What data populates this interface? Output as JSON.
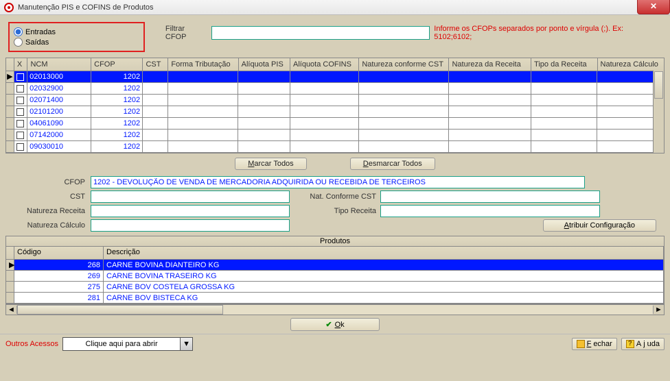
{
  "title": "Manutenção PIS e COFINS de Produtos",
  "radios": {
    "entradas": "Entradas",
    "saidas": "Saídas"
  },
  "filter": {
    "label": "Filtrar CFOP",
    "value": "",
    "hint": "Informe os CFOPs separados por ponto e vírgula (;). Ex: 5102;6102;"
  },
  "grid": {
    "headers": {
      "x": "X",
      "ncm": "NCM",
      "cfop": "CFOP",
      "cst": "CST",
      "ft": "Forma Tributação",
      "apis": "Alíquota PIS",
      "acof": "Alíquota COFINS",
      "ncst": "Natureza conforme CST",
      "nrec": "Natureza da Receita",
      "trec": "Tipo da Receita",
      "ncalc": "Natureza Cálculo"
    },
    "rows": [
      {
        "ncm": "02013000",
        "cfop": "1202",
        "selected": true
      },
      {
        "ncm": "02032900",
        "cfop": "1202"
      },
      {
        "ncm": "02071400",
        "cfop": "1202"
      },
      {
        "ncm": "02101200",
        "cfop": "1202"
      },
      {
        "ncm": "04061090",
        "cfop": "1202"
      },
      {
        "ncm": "07142000",
        "cfop": "1202"
      },
      {
        "ncm": "09030010",
        "cfop": "1202"
      }
    ]
  },
  "buttons": {
    "marcar": "Marcar Todos",
    "desmarcar": "Desmarcar Todos",
    "atribuir": "Atribuir Configuração",
    "ok": "Ok",
    "fechar": "Fechar",
    "ajuda": "Ajuda"
  },
  "icons": {
    "marcar_u": "M",
    "desmarcar_u": "D",
    "atribuir_u": "A",
    "ok_u": "O",
    "fechar_u": "F",
    "ajuda_u": "j"
  },
  "form": {
    "cfop_label": "CFOP",
    "cfop_value": "1202 - DEVOLUÇÃO DE VENDA DE MERCADORIA ADQUIRIDA OU RECEBIDA DE TERCEIROS",
    "cst_label": "CST",
    "cst_value": "",
    "ncst_label": "Nat. Conforme CST",
    "ncst_value": "",
    "nrec_label": "Natureza Receita",
    "nrec_value": "",
    "trec_label": "Tipo Receita",
    "trec_value": "",
    "ncalc_label": "Natureza Cálculo",
    "ncalc_value": ""
  },
  "produtos": {
    "title": "Produtos",
    "headers": {
      "codigo": "Código",
      "descricao": "Descrição"
    },
    "rows": [
      {
        "codigo": "268",
        "descricao": "CARNE BOVINA DIANTEIRO KG",
        "selected": true
      },
      {
        "codigo": "269",
        "descricao": "CARNE BOVINA TRASEIRO KG"
      },
      {
        "codigo": "275",
        "descricao": "CARNE BOV COSTELA GROSSA KG"
      },
      {
        "codigo": "281",
        "descricao": "CARNE BOV BISTECA KG"
      }
    ]
  },
  "bottom": {
    "outros": "Outros Acessos",
    "combo": "Clique aqui para abrir"
  }
}
